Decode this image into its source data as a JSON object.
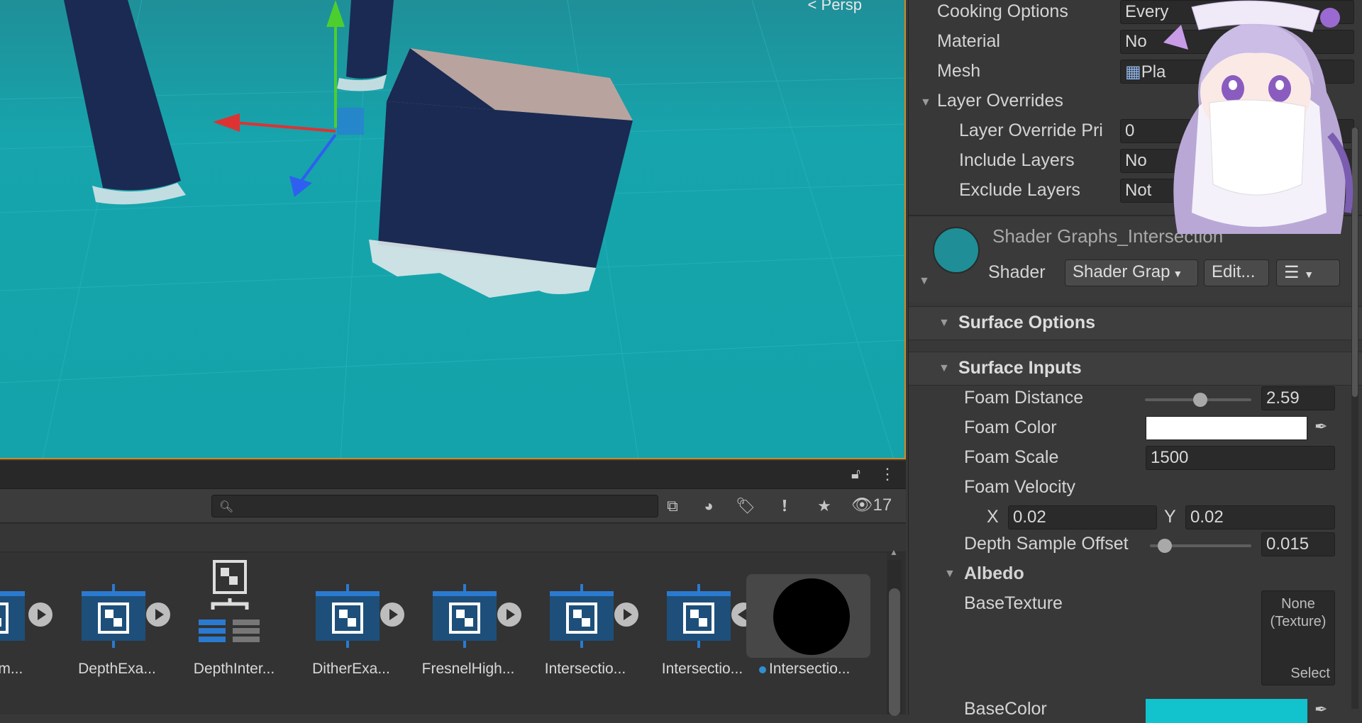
{
  "scene": {
    "view_mode": "Persp"
  },
  "project": {
    "search": {
      "placeholder": ""
    },
    "hidden_count": "17",
    "assets": [
      {
        "label": "...xam..."
      },
      {
        "label": "DepthExa..."
      },
      {
        "label": "DepthInter..."
      },
      {
        "label": "DitherExa..."
      },
      {
        "label": "FresnelHigh..."
      },
      {
        "label": "Intersectio..."
      },
      {
        "label": "Intersectio..."
      },
      {
        "label": "Intersectio..."
      }
    ]
  },
  "inspector": {
    "cooking_options": {
      "label": "Cooking Options",
      "value": "Every"
    },
    "material": {
      "label": "Material",
      "value": "No"
    },
    "mesh": {
      "label": "Mesh",
      "value": "Pla"
    },
    "layer_overrides": {
      "label": "Layer Overrides",
      "priority": {
        "label": "Layer Override Pri",
        "value": "0"
      },
      "include": {
        "label": "Include Layers",
        "value": "No"
      },
      "exclude": {
        "label": "Exclude Layers",
        "value": "Not"
      }
    },
    "material_header": {
      "name": "Shader Graphs_Intersection",
      "shader_label": "Shader",
      "shader_value": "Shader Grap",
      "edit_label": "Edit..."
    },
    "surface_options": {
      "title": "Surface Options"
    },
    "surface_inputs": {
      "title": "Surface Inputs",
      "foam_distance": {
        "label": "Foam Distance",
        "value": "2.59",
        "slider": 0.52
      },
      "foam_color": {
        "label": "Foam Color",
        "color": "#ffffff"
      },
      "foam_scale": {
        "label": "Foam Scale",
        "value": "1500"
      },
      "foam_velocity": {
        "label": "Foam Velocity",
        "x_label": "X",
        "x": "0.02",
        "y_label": "Y",
        "y": "0.02"
      },
      "depth_sample_offset": {
        "label": "Depth Sample Offset",
        "value": "0.015",
        "slider": 0.15
      },
      "albedo": {
        "title": "Albedo",
        "base_texture": {
          "label": "BaseTexture",
          "none_text": "None\n(Texture)",
          "select_label": "Select"
        },
        "base_color": {
          "label": "BaseColor",
          "color": "#12c2cc"
        }
      }
    }
  },
  "colors": {
    "scene_water": "#14a3aa",
    "object_navy": "#1b2a52",
    "selection_outline": "#d08a22",
    "shader_asset_blue": "#1d4f7a"
  }
}
